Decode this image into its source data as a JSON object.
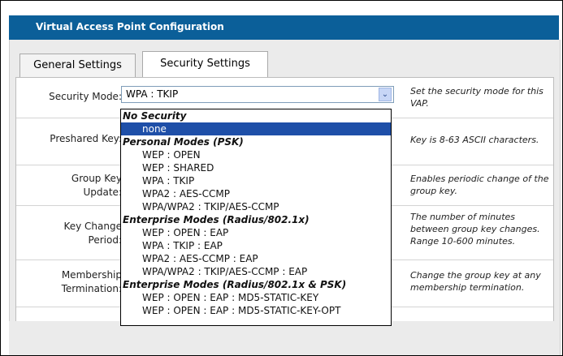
{
  "window": {
    "title": "Virtual Access Point Configuration"
  },
  "tabs": [
    {
      "label": "General Settings"
    },
    {
      "label": "Security Settings"
    }
  ],
  "fields": {
    "security_mode": {
      "label": "Security Mode:",
      "value": "WPA : TKIP",
      "help": "Set the security mode for this VAP."
    },
    "preshared_key": {
      "label": "Preshared Key:",
      "help": "Key is 8-63 ASCII characters."
    },
    "group_key_update": {
      "label_line1": "Group Key",
      "label_line2": "Update:",
      "help": "Enables periodic change of the group key."
    },
    "key_change_period": {
      "label_line1": "Key Change",
      "label_line2": "Period:",
      "help": "The number of minutes between group key changes. Range 10-600 minutes."
    },
    "membership_termination": {
      "label_line1": "Membership",
      "label_line2": "Termination:",
      "help": "Change the group key at any membership termination."
    }
  },
  "dropdown": {
    "options": [
      {
        "text": "No Security",
        "type": "group"
      },
      {
        "text": "none",
        "type": "item",
        "selected": true
      },
      {
        "text": "Personal Modes (PSK)",
        "type": "group"
      },
      {
        "text": "WEP : OPEN",
        "type": "item"
      },
      {
        "text": "WEP : SHARED",
        "type": "item"
      },
      {
        "text": "WPA : TKIP",
        "type": "item"
      },
      {
        "text": "WPA2 : AES-CCMP",
        "type": "item"
      },
      {
        "text": "WPA/WPA2 : TKIP/AES-CCMP",
        "type": "item"
      },
      {
        "text": "Enterprise Modes (Radius/802.1x)",
        "type": "group"
      },
      {
        "text": "WEP : OPEN : EAP",
        "type": "item"
      },
      {
        "text": "WPA : TKIP : EAP",
        "type": "item"
      },
      {
        "text": "WPA2 : AES-CCMP : EAP",
        "type": "item"
      },
      {
        "text": "WPA/WPA2 : TKIP/AES-CCMP : EAP",
        "type": "item"
      },
      {
        "text": "Enterprise Modes (Radius/802.1x & PSK)",
        "type": "group"
      },
      {
        "text": "WEP : OPEN : EAP : MD5-STATIC-KEY",
        "type": "item"
      },
      {
        "text": "WEP : OPEN : EAP : MD5-STATIC-KEY-OPT",
        "type": "item"
      }
    ]
  },
  "colors": {
    "titlebar": "#0b5f99",
    "selection": "#1e4fa8"
  }
}
